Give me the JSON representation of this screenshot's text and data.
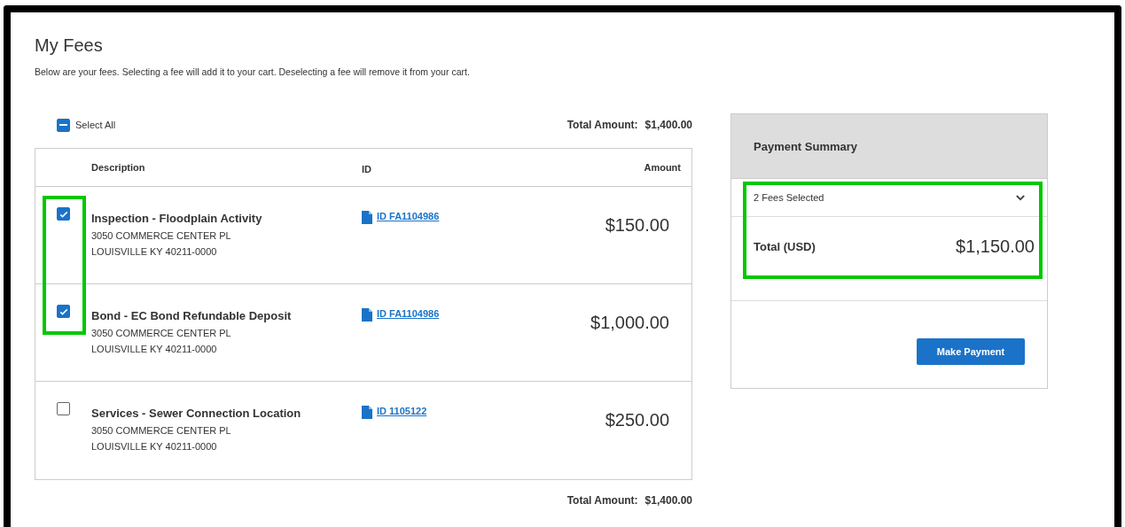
{
  "title": "My Fees",
  "intro": "Below are your fees. Selecting a fee will add it to your cart. Deselecting a fee will remove it from your cart.",
  "select_all": {
    "label": "Select All",
    "indeterminate": true
  },
  "total_top": {
    "label": "Total Amount:",
    "value": "$1,400.00"
  },
  "columns": [
    "Description",
    "ID",
    "Amount"
  ],
  "fees": [
    {
      "selected": true,
      "highlighted": true,
      "description": "Inspection - Floodplain Activity",
      "address": [
        "3050 COMMERCE CENTER PL",
        "LOUISVILLE KY 40211-0000"
      ],
      "id": "ID FA1104986",
      "amount": "$150.00"
    },
    {
      "selected": true,
      "highlighted": true,
      "description": "Bond - EC Bond Refundable Deposit",
      "address": [
        "3050 COMMERCE CENTER PL",
        "LOUISVILLE KY 40211-0000"
      ],
      "id": "ID FA1104986",
      "amount": "$1,000.00"
    },
    {
      "selected": false,
      "highlighted": false,
      "description": "Services - Sewer Connection Location",
      "address": [
        "3050 COMMERCE CENTER PL",
        "LOUISVILLE KY 40211-0000"
      ],
      "id": "ID 1105122",
      "amount": "$250.00"
    }
  ],
  "total_bottom": {
    "label": "Total Amount:",
    "value": "$1,400.00"
  },
  "summary": {
    "title": "Payment Summary",
    "selected_count": "2 Fees Selected",
    "expanded": false,
    "total_label": "Total (USD)",
    "total": "$1,150.00",
    "highlighted": true,
    "button": "Make Payment"
  }
}
